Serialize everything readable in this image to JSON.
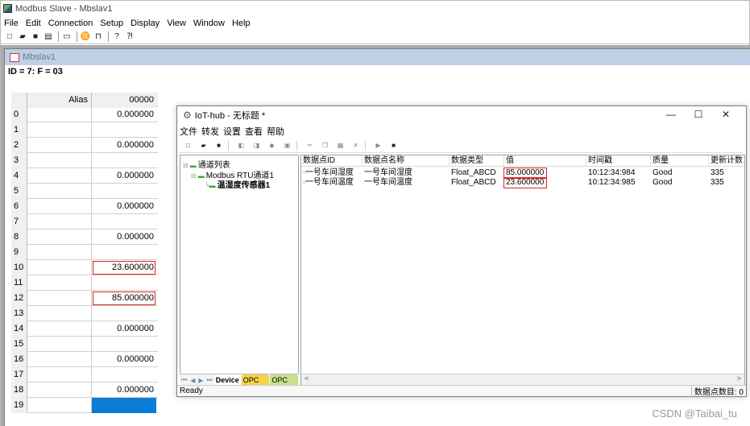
{
  "app": {
    "title": "Modbus Slave - Mbslav1",
    "menu": [
      "File",
      "Edit",
      "Connection",
      "Setup",
      "Display",
      "View",
      "Window",
      "Help"
    ]
  },
  "child": {
    "title": "Mbslav1",
    "id_line": "ID = 7: F = 03",
    "header": {
      "alias": "Alias",
      "address": "00000"
    },
    "rows": [
      {
        "index": "0",
        "value": "0.000000"
      },
      {
        "index": "1",
        "value": ""
      },
      {
        "index": "2",
        "value": "0.000000"
      },
      {
        "index": "3",
        "value": ""
      },
      {
        "index": "4",
        "value": "0.000000"
      },
      {
        "index": "5",
        "value": ""
      },
      {
        "index": "6",
        "value": "0.000000"
      },
      {
        "index": "7",
        "value": ""
      },
      {
        "index": "8",
        "value": "0.000000"
      },
      {
        "index": "9",
        "value": ""
      },
      {
        "index": "10",
        "value": "23.600000"
      },
      {
        "index": "11",
        "value": ""
      },
      {
        "index": "12",
        "value": "85.000000"
      },
      {
        "index": "13",
        "value": ""
      },
      {
        "index": "14",
        "value": "0.000000"
      },
      {
        "index": "15",
        "value": ""
      },
      {
        "index": "16",
        "value": "0.000000"
      },
      {
        "index": "17",
        "value": ""
      },
      {
        "index": "18",
        "value": "0.000000"
      },
      {
        "index": "19",
        "value": ""
      }
    ]
  },
  "iot": {
    "title": "IoT-hub - 无标题 *",
    "menu": [
      "文件",
      "转发",
      "设置",
      "查看",
      "帮助"
    ],
    "tree": {
      "root": "通道列表",
      "channel": "Modbus RTU通道1",
      "device": "温湿度传感器1"
    },
    "tabs": [
      "Device",
      "OPC DA",
      "OPC UA"
    ],
    "columns": [
      "数据点ID",
      "数据点名称",
      "数据类型",
      "值",
      "时间戳",
      "质量",
      "更新计数"
    ],
    "rows": [
      {
        "id": "一号车间湿度",
        "name": "一号车间湿度",
        "type": "Float_ABCD",
        "value": "85.000000",
        "time": "10:12:34:984",
        "quality": "Good",
        "count": "335"
      },
      {
        "id": "一号车间温度",
        "name": "一号车间温度",
        "type": "Float_ABCD",
        "value": "23.600000",
        "time": "10:12:34:985",
        "quality": "Good",
        "count": "335"
      }
    ],
    "status_left": "Ready",
    "status_right": "数据点数目: 0"
  },
  "watermark": "CSDN @Taibai_tu"
}
